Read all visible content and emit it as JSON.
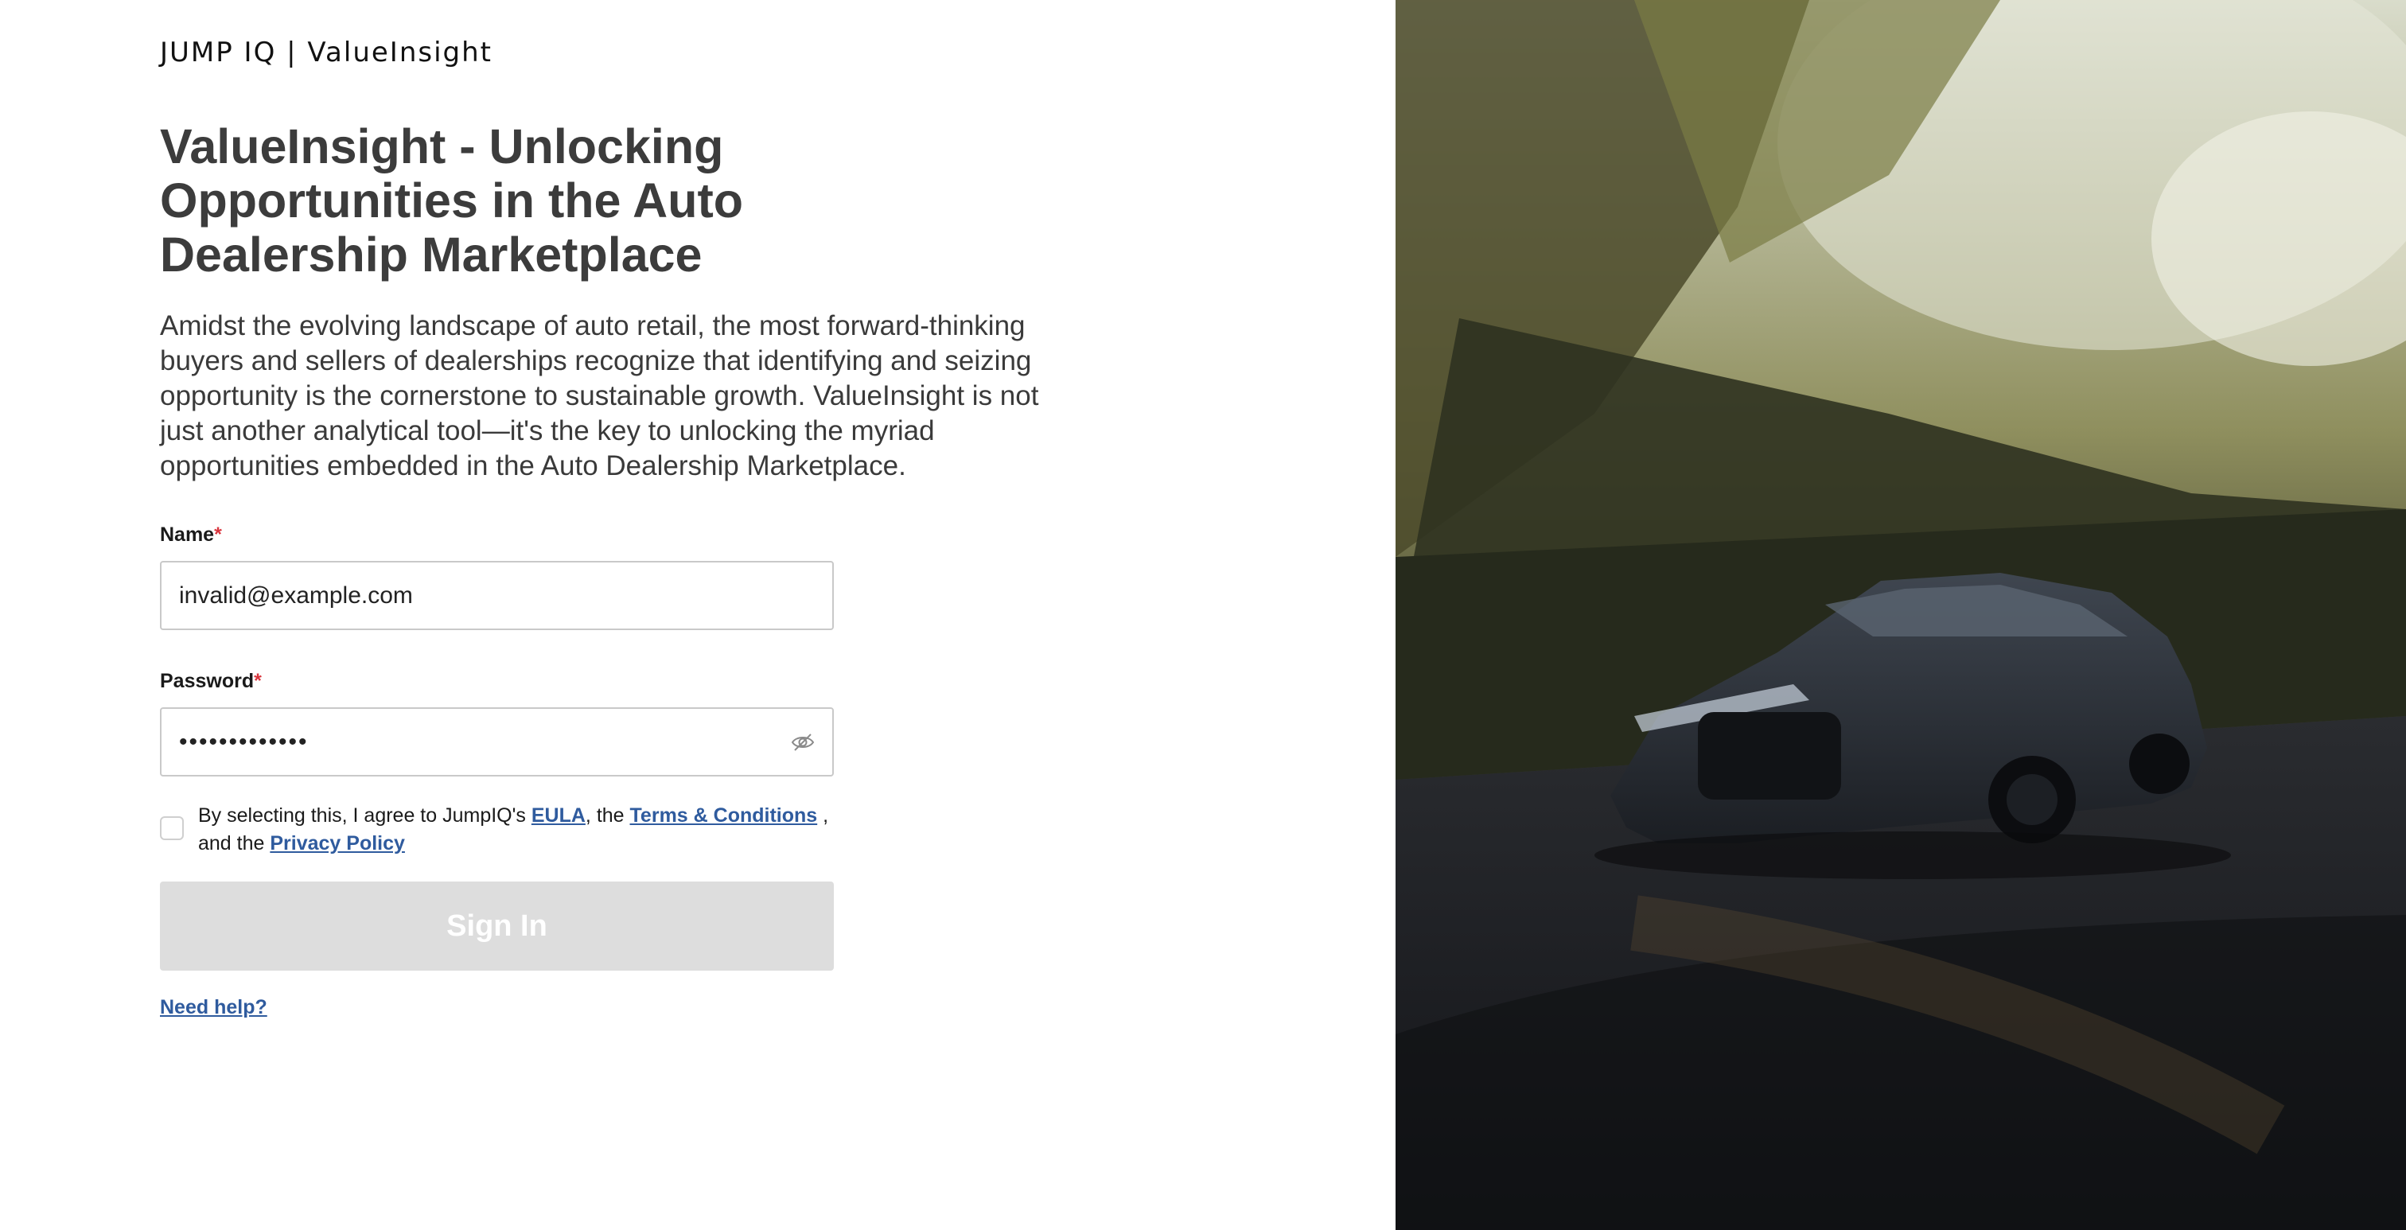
{
  "brand": {
    "logo_text": "JUMP IQ | ValueInsight"
  },
  "hero": {
    "headline": "ValueInsight - Unlocking Opportunities in the Auto Dealership Marketplace",
    "intro": "Amidst the evolving landscape of auto retail, the most forward-thinking buyers and sellers of dealerships recognize that identifying and seizing opportunity is the cornerstone to sustainable growth. ValueInsight is not just another analytical tool—it's the key to unlocking the myriad opportunities embedded in the Auto Dealership Marketplace."
  },
  "form": {
    "name_label": "Name",
    "password_label": "Password",
    "required_marker": "*",
    "name_value": "invalid@example.com",
    "password_value": "•••••••••••••",
    "agreement": {
      "text_before": "By selecting this, I agree to JumpIQ's ",
      "eula_link": "EULA",
      "text_middle": ", the ",
      "terms_link": "Terms & Conditions",
      "text_after": " , and the ",
      "privacy_link": "Privacy Policy",
      "checked": false
    },
    "signin_label": "Sign In",
    "signin_enabled": false,
    "help_link": "Need help?"
  },
  "icons": {
    "password_toggle": "eye-slash-icon"
  },
  "colors": {
    "required": "#d9363e",
    "link": "#2f5b9e",
    "button_disabled": "#dddddd",
    "heading": "#3c3c3c"
  }
}
